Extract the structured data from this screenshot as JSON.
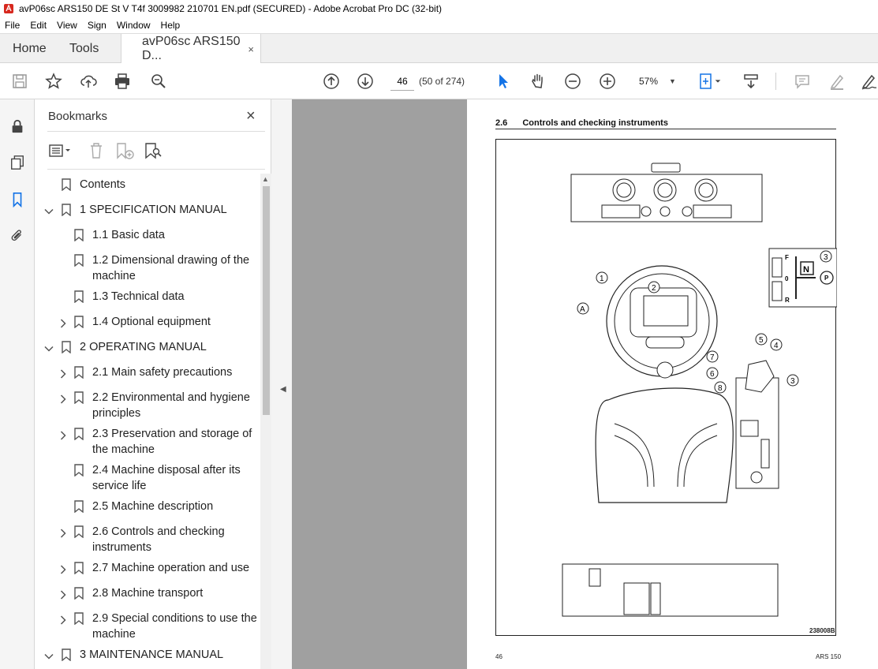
{
  "window": {
    "title": "avP06sc ARS150 DE St V T4f 3009982 210701 EN.pdf (SECURED) - Adobe Acrobat Pro DC (32-bit)"
  },
  "menu": [
    "File",
    "Edit",
    "View",
    "Sign",
    "Window",
    "Help"
  ],
  "tabs": {
    "home": "Home",
    "tools": "Tools",
    "doc": "avP06sc ARS150 D...",
    "doc_close": "×"
  },
  "toolbar": {
    "page_current": "46",
    "page_count": "(50 of 274)",
    "zoom": "57%"
  },
  "bookmarks": {
    "title": "Bookmarks",
    "close": "×",
    "items": [
      {
        "label": "Contents"
      },
      {
        "label": "1 SPECIFICATION MANUAL"
      },
      {
        "label": "1.1 Basic data"
      },
      {
        "label": "1.2 Dimensional drawing of the machine"
      },
      {
        "label": "1.3 Technical data"
      },
      {
        "label": "1.4 Optional equipment"
      },
      {
        "label": "2 OPERATING MANUAL"
      },
      {
        "label": "2.1 Main safety precautions"
      },
      {
        "label": "2.2 Environmental and hygiene principles"
      },
      {
        "label": "2.3 Preservation and storage of the machine"
      },
      {
        "label": "2.4 Machine disposal after its service life"
      },
      {
        "label": "2.5 Machine description"
      },
      {
        "label": "2.6 Controls and checking instruments"
      },
      {
        "label": "2.7 Machine operation and use"
      },
      {
        "label": "2.8 Machine transport"
      },
      {
        "label": "2.9 Special conditions to use the machine"
      },
      {
        "label": "3 MAINTENANCE MANUAL"
      }
    ]
  },
  "page": {
    "section_num": "2.6",
    "section_title": "Controls and checking instruments",
    "figure_ref": "238008B",
    "footer_left": "46",
    "footer_right": "ARS 150",
    "callouts": [
      "1",
      "2",
      "A",
      "3",
      "4",
      "5",
      "7",
      "6",
      "8",
      "3"
    ],
    "gear_labels": [
      "F",
      "N",
      "0",
      "R",
      "P"
    ]
  }
}
